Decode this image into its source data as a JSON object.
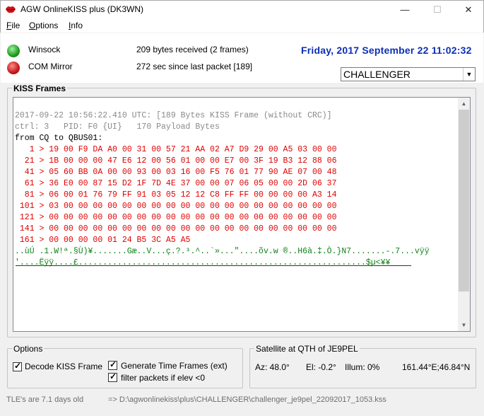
{
  "window": {
    "title": "AGW OnlineKISS plus (DK3WN)",
    "minimize_glyph": "—",
    "maximize_glyph": "☐",
    "close_glyph": "✕"
  },
  "menu": {
    "items": [
      {
        "label": "File",
        "accel": "F",
        "rest": "ile"
      },
      {
        "label": "Options",
        "accel": "O",
        "rest": "ptions"
      },
      {
        "label": "Info",
        "accel": "I",
        "rest": "nfo"
      }
    ]
  },
  "status": {
    "winsock_label": "Winsock",
    "com_label": "COM Mirror",
    "bytes_received": "209 bytes received (2 frames)",
    "since_last": "272 sec since last packet [189]",
    "datetime": "Friday, 2017 September 22  11:02:32",
    "winsock_color": "#1f9a1f",
    "com_color": "#c41818"
  },
  "satellite_select": {
    "value": "CHALLENGER"
  },
  "kiss": {
    "group_label": "KISS Frames",
    "header_lines": [
      "2017-09-22 10:56:22.410 UTC: [189 Bytes KISS Frame (without CRC)]",
      "ctrl: 3   PID: F0 {UI}   170 Payload Bytes"
    ],
    "from_line": "from CQ to QBUS01:",
    "hex_lines": [
      "   1 > 19 00 F9 DA A0 00 31 00 57 21 AA 02 A7 D9 29 00 A5 03 00 00",
      "  21 > 1B 00 00 00 47 E6 12 00 56 01 00 00 E7 00 3F 19 B3 12 88 06",
      "  41 > 05 60 BB 0A 00 00 93 00 03 16 00 F5 76 01 77 90 AE 07 00 48",
      "  61 > 36 E0 00 87 15 D2 1F 7D 4E 37 00 00 07 06 05 00 00 2D 06 37",
      "  81 > 06 00 01 76 79 FF 91 03 05 12 12 C8 FF FF 00 00 00 00 A3 14",
      " 101 > 03 00 00 00 00 00 00 00 00 00 00 00 00 00 00 00 00 00 00 00",
      " 121 > 00 00 00 00 00 00 00 00 00 00 00 00 00 00 00 00 00 00 00 00",
      " 141 > 00 00 00 00 00 00 00 00 00 00 00 00 00 00 00 00 00 00 00 00",
      " 161 > 00 00 00 00 01 24 B5 3C A5 A5"
    ],
    "ascii_lines": [
      "..ùÚ .1.W!ª.§Ù)¥.......Gæ..V...ç.?.³.^..`»...\"....õv.w ®..H6à.‡.Ò.}N7.......-.7...vÿÿ",
      "'....Ëÿÿ....£...........................................................$µ<¥¥"
    ],
    "colors": {
      "header": "#8a8a8a",
      "hex": "#e00000",
      "ascii": "#13831b"
    }
  },
  "options": {
    "group_label": "Options",
    "decode_kiss": "Decode KISS Frame",
    "generate_time": "Generate Time Frames (ext)",
    "filter_packets": "filter packets if elev <0"
  },
  "satellite_info": {
    "group_label": "Satellite at QTH of JE9PEL",
    "az": "Az: 48.0°",
    "el": "El: -0.2°",
    "illum": "Illum: 0%",
    "position": "161.44°E;46.84°N"
  },
  "statusbar": {
    "tle_age": "TLE's are 7.1 days old",
    "file_path": "=> D:\\agwonlinekiss\\plus\\CHALLENGER\\challenger_je9pel_22092017_1053.kss"
  }
}
